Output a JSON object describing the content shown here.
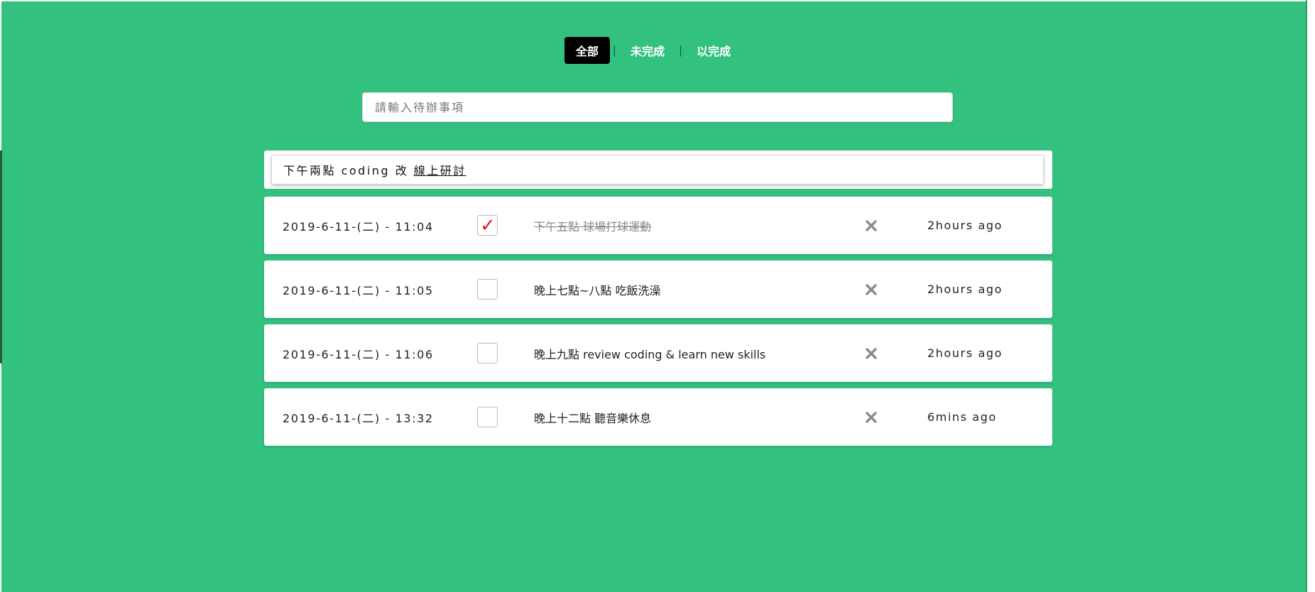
{
  "filters": {
    "all": "全部",
    "active": "未完成",
    "completed": "以完成",
    "separator": "|"
  },
  "new_todo": {
    "placeholder": "請輸入待辦事項"
  },
  "editing": {
    "text_plain": "下午兩點 coding 改 ",
    "text_underlined": "線上研討"
  },
  "todos": [
    {
      "date": "2019-6-11-(二) - 11:04",
      "title": "下午五點 球場打球運動",
      "completed": true,
      "time_ago": "2hours ago"
    },
    {
      "date": "2019-6-11-(二) - 11:05",
      "title": "晚上七點~八點 吃飯洗澡",
      "completed": false,
      "time_ago": "2hours ago"
    },
    {
      "date": "2019-6-11-(二) - 11:06",
      "title": "晚上九點 review coding & learn new skills",
      "completed": false,
      "time_ago": "2hours ago"
    },
    {
      "date": "2019-6-11-(二) - 13:32",
      "title": "晚上十二點 聽音樂休息",
      "completed": false,
      "time_ago": "6mins ago"
    }
  ],
  "icons": {
    "checkmark": "✓",
    "delete": "close-icon"
  },
  "colors": {
    "background": "#33c180",
    "active_tab": "#000000",
    "check": "#e8141b",
    "delete": "#8a8a8a"
  }
}
